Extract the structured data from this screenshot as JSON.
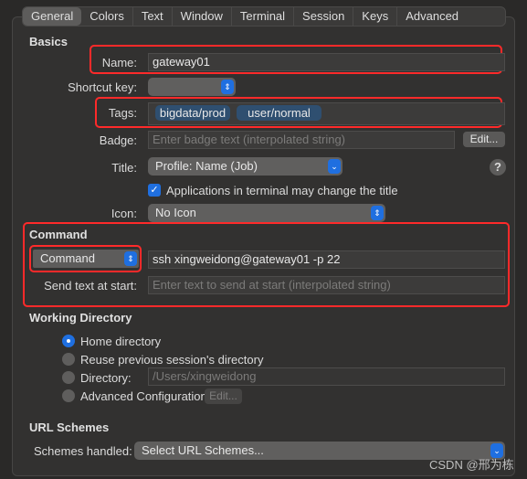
{
  "tabs": [
    "General",
    "Colors",
    "Text",
    "Window",
    "Terminal",
    "Session",
    "Keys",
    "Advanced"
  ],
  "basics": {
    "header": "Basics",
    "name_label": "Name:",
    "name_value": "gateway01",
    "shortcut_label": "Shortcut key:",
    "tags_label": "Tags:",
    "tags": [
      "bigdata/prod",
      "user/normal"
    ],
    "badge_label": "Badge:",
    "badge_placeholder": "Enter badge text (interpolated string)",
    "edit_label": "Edit...",
    "title_label": "Title:",
    "title_value": "Profile: Name (Job)",
    "help": "?",
    "checkbox_label": "Applications in terminal may change the title",
    "checkbox_checked": true,
    "icon_label": "Icon:",
    "icon_value": "No Icon"
  },
  "command": {
    "header": "Command",
    "mode": "Command",
    "value": "ssh xingweidong@gateway01 -p 22",
    "send_label": "Send text at start:",
    "send_placeholder": "Enter text to send at start (interpolated string)"
  },
  "workdir": {
    "header": "Working Directory",
    "options": [
      "Home directory",
      "Reuse previous session's directory",
      "Directory:",
      "Advanced Configuration"
    ],
    "selected": 0,
    "directory_value": "/Users/xingweidong",
    "edit_label": "Edit..."
  },
  "url": {
    "header": "URL Schemes",
    "label": "Schemes handled:",
    "value": "Select URL Schemes..."
  },
  "watermark": "CSDN @邢为栋",
  "colors": {
    "accent": "#1f6fe0",
    "highlight": "#ff2a2a",
    "tag": "#2f4f70"
  }
}
